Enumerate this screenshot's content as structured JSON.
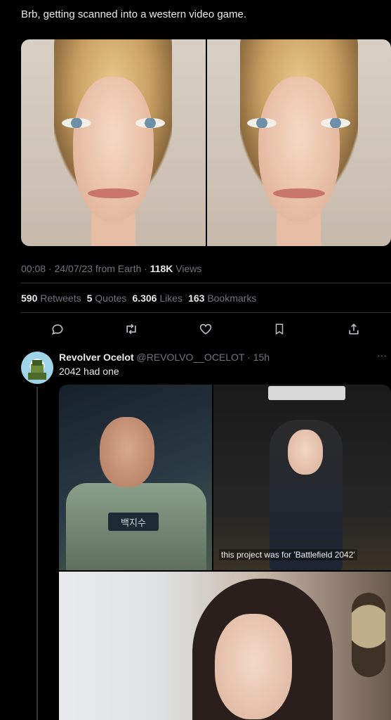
{
  "tweet": {
    "text": "Brb, getting scanned into a western video game.",
    "time": "00:08",
    "date": "24/07/23",
    "source": "from Earth",
    "views_count": "118K",
    "views_label": "Views",
    "retweets_count": "590",
    "retweets_label": "Retweets",
    "quotes_count": "5",
    "quotes_label": "Quotes",
    "likes_count": "6.306",
    "likes_label": "Likes",
    "bookmarks_count": "163",
    "bookmarks_label": "Bookmarks"
  },
  "reply": {
    "name": "Revolver Ocelot",
    "handle": "@REVOLVO__OCELOT",
    "time": "15h",
    "text": "2042 had one",
    "badge_text": "백지수",
    "caption": "this project was for 'Battlefield 2042'"
  },
  "icons": {
    "actions": [
      "reply-icon",
      "retweet-icon",
      "like-icon",
      "bookmark-icon",
      "share-icon"
    ]
  },
  "colors": {
    "background": "#000000",
    "text": "#e7e9ea",
    "muted": "#71767b",
    "divider": "#2f3336"
  }
}
